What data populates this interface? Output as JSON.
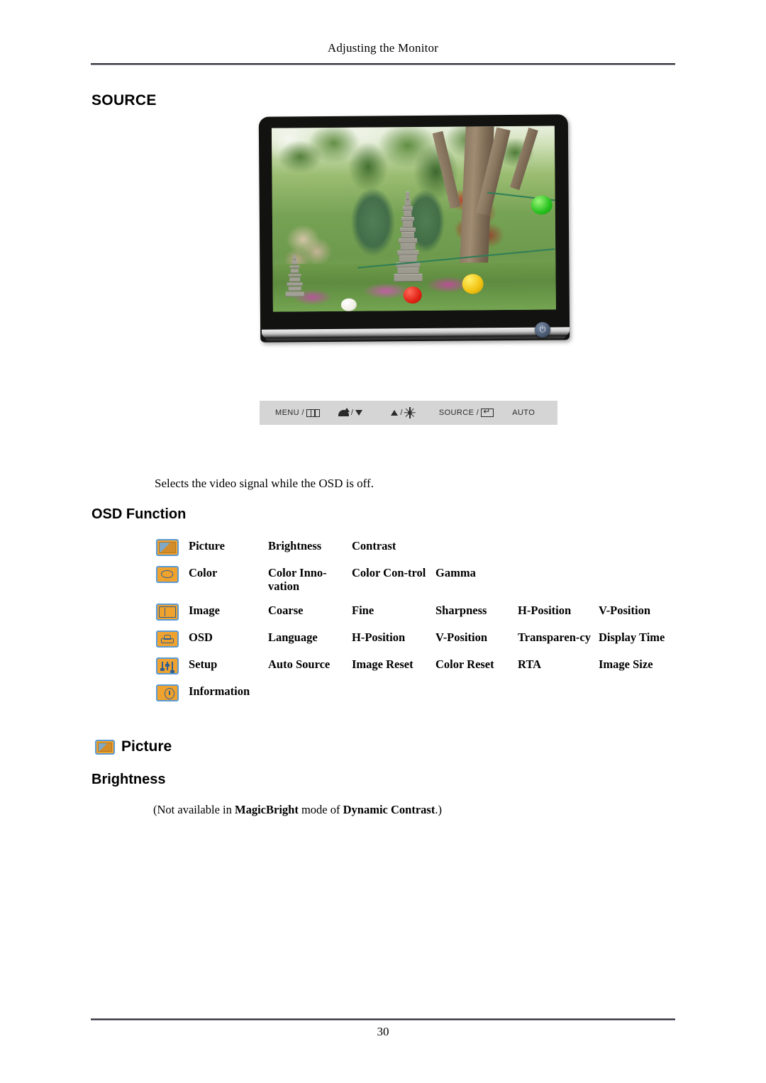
{
  "header": {
    "running_title": "Adjusting the Monitor"
  },
  "source_section": {
    "heading": "SOURCE",
    "caption": "Selects the video signal while the OSD is off."
  },
  "monitor": {
    "power_button_icon": "power-icon",
    "screen_description": "garden-photo"
  },
  "button_strip": {
    "buttons": [
      {
        "label": "MENU /",
        "icon": "menu-icon"
      },
      {
        "label": "/",
        "icon_left": "contrast-icon",
        "icon_right": "triangle-down-icon"
      },
      {
        "label": "/",
        "icon_left": "triangle-up-icon",
        "icon_right": "brightness-sun-icon"
      },
      {
        "label": "SOURCE /",
        "icon": "enter-icon"
      },
      {
        "label": "AUTO",
        "icon": ""
      }
    ]
  },
  "osd_function": {
    "heading": "OSD Function",
    "rows": [
      {
        "icon": "picture-icon",
        "name": "Picture",
        "items": [
          "Brightness",
          "Contrast",
          "",
          "",
          ""
        ]
      },
      {
        "icon": "color-palette-icon",
        "name": "Color",
        "items": [
          "Color Inno-vation",
          "Color Con-trol",
          "Gamma",
          "",
          ""
        ]
      },
      {
        "icon": "image-icon",
        "name": "Image",
        "items": [
          "Coarse",
          "Fine",
          "Sharpness",
          "H-Position",
          "V-Position"
        ]
      },
      {
        "icon": "osd-icon",
        "name": "OSD",
        "items": [
          "Language",
          "H-Position",
          "V-Position",
          "Transparen-cy",
          "Display Time"
        ]
      },
      {
        "icon": "setup-sliders-icon",
        "name": "Setup",
        "items": [
          "Auto Source",
          "Image Reset",
          "Color Reset",
          "RTA",
          "Image Size"
        ]
      },
      {
        "icon": "information-clock-icon",
        "name": "Information",
        "items": [
          "",
          "",
          "",
          "",
          ""
        ]
      }
    ]
  },
  "picture_section": {
    "heading": "Picture",
    "icon": "picture-icon",
    "subheading": "Brightness",
    "note_prefix": "(Not available in ",
    "note_bold1": "MagicBright",
    "note_middle": " mode of ",
    "note_bold2": "Dynamic Contrast",
    "note_suffix": ".)"
  },
  "footer": {
    "page_number": "30"
  },
  "colors": {
    "icon_fill": "#f0a22e",
    "icon_border": "#5b9bd5",
    "icon_detail": "#2f5f8f",
    "strip_bg": "#d5d5d5",
    "rule": "#3a3a44"
  }
}
